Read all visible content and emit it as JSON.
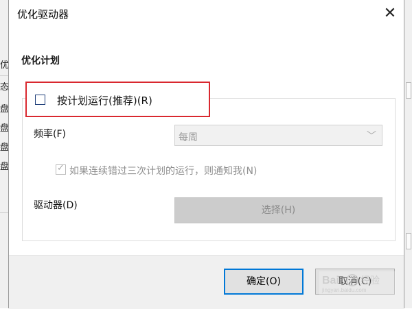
{
  "dialog": {
    "title": "优化驱动器",
    "close_glyph": "✕"
  },
  "schedule": {
    "section_title": "优化计划",
    "run_on_schedule_label": "按计划运行(推荐)(R)",
    "run_on_schedule_checked": false,
    "frequency_label": "频率(F)",
    "frequency_value": "每周",
    "notify_label": "如果连续错过三次计划的运行，则通知我(N)",
    "notify_checked": true,
    "drives_label": "驱动器(D)",
    "choose_button_label": "选择(H)"
  },
  "footer": {
    "ok_label": "确定(O)",
    "cancel_label": "取消(C)"
  },
  "background": {
    "fragments": [
      "优",
      "态",
      "盘",
      "盘",
      "盘",
      "盘"
    ]
  },
  "icons": {
    "checkbox_check": "✓",
    "dropdown_chevron": "﹀"
  },
  "colors": {
    "highlight": "#d9282f",
    "focus_border": "#0078d7",
    "footer_bg": "#f0f0f0"
  }
}
